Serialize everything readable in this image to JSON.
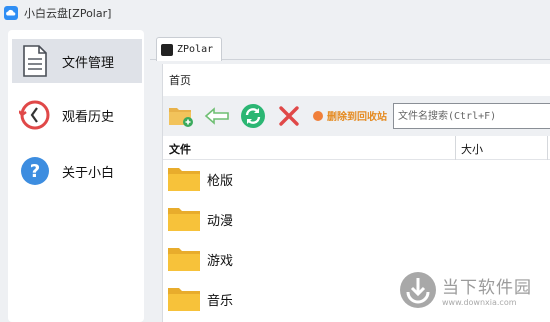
{
  "window": {
    "title": "小白云盘[ZPolar]"
  },
  "sidebar": {
    "items": [
      {
        "label": "文件管理",
        "icon": "document-icon",
        "active": true
      },
      {
        "label": "观看历史",
        "icon": "history-clock-icon",
        "active": false
      },
      {
        "label": "关于小白",
        "icon": "help-icon",
        "active": false
      }
    ]
  },
  "tabs": [
    {
      "label": "ZPolar"
    }
  ],
  "breadcrumb": "首页",
  "toolbar": {
    "new_folder_icon": "new-folder-icon",
    "back_icon": "back-arrow-icon",
    "refresh_icon": "refresh-icon",
    "delete_icon": "delete-x-icon",
    "recycle_label": "删除到回收站",
    "search_placeholder": "文件名搜索(Ctrl+F)"
  },
  "table": {
    "columns": [
      "文件",
      "大小"
    ],
    "rows": [
      {
        "name": "枪版",
        "type": "folder"
      },
      {
        "name": "动漫",
        "type": "folder"
      },
      {
        "name": "游戏",
        "type": "folder"
      },
      {
        "name": "音乐",
        "type": "folder"
      }
    ]
  },
  "watermark": {
    "cn": "当下软件园",
    "url": "www.downxia.com"
  },
  "colors": {
    "accent_green": "#3aaa5c",
    "delete_red": "#e04848",
    "folder_yellow": "#f7c23a",
    "recycle_orange": "#e58a1f"
  }
}
